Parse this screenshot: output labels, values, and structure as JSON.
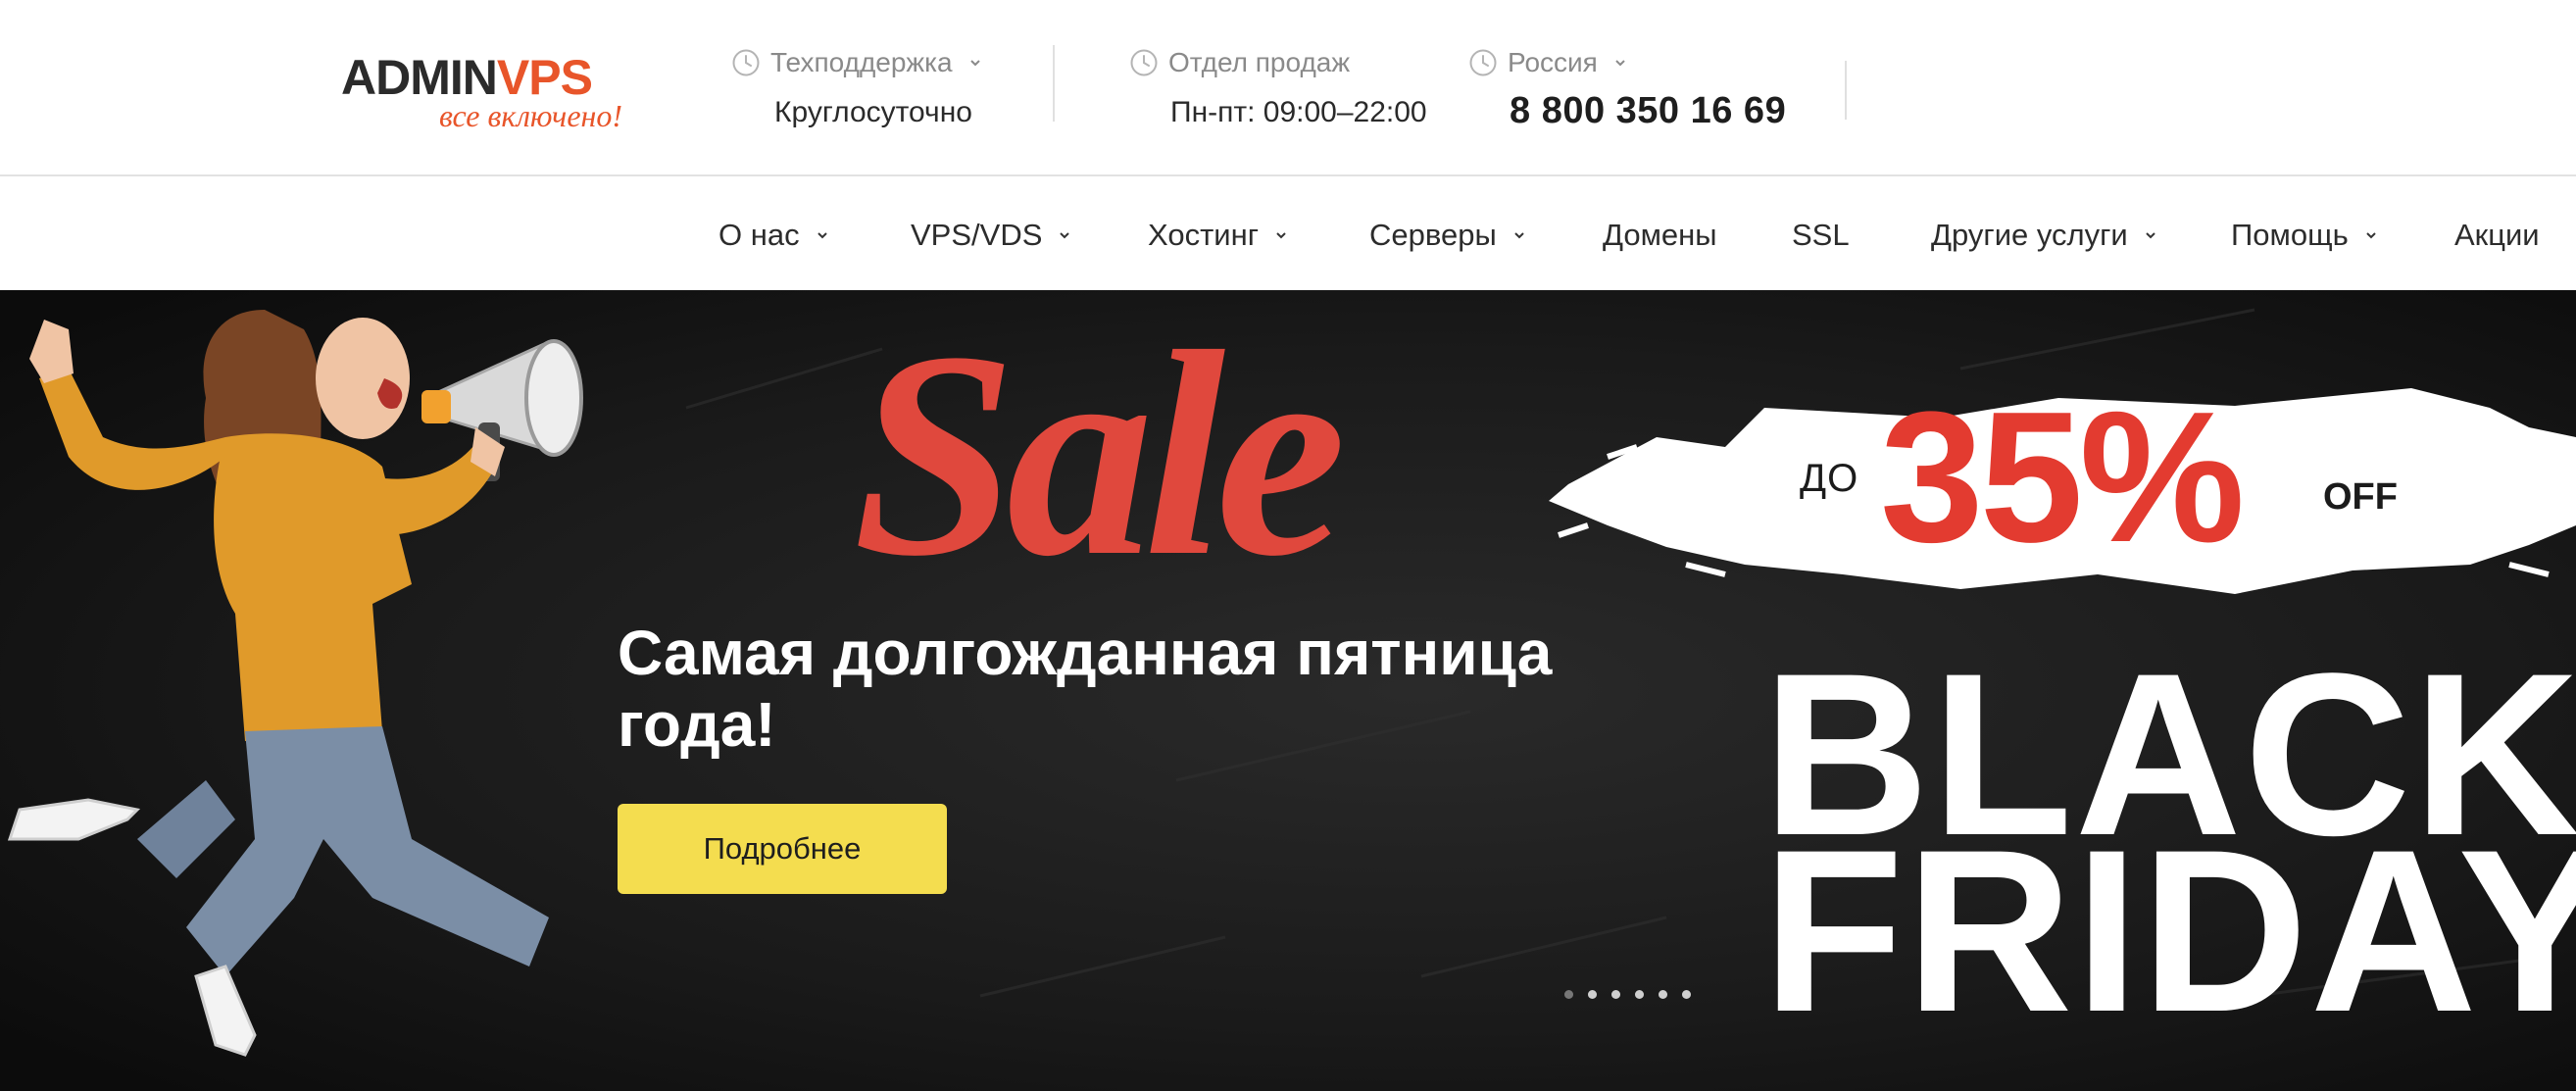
{
  "brand": {
    "logo_main": "ADMIN",
    "logo_accent": "VPS",
    "tagline": "все включено!"
  },
  "header": {
    "support": {
      "label": "Техподдержка",
      "value": "Круглосуточно",
      "icon": "clock-icon"
    },
    "sales": {
      "label": "Отдел продаж",
      "value": "Пн-пт: 09:00–22:00",
      "icon": "clock-icon"
    },
    "region": {
      "label": "Россия",
      "value": "8 800 350 16 69",
      "icon": "clock-icon"
    }
  },
  "nav": {
    "items": [
      {
        "label": "О нас",
        "dropdown": true
      },
      {
        "label": "VPS/VDS",
        "dropdown": true
      },
      {
        "label": "Хостинг",
        "dropdown": true
      },
      {
        "label": "Серверы",
        "dropdown": true
      },
      {
        "label": "Домены",
        "dropdown": false
      },
      {
        "label": "SSL",
        "dropdown": false
      },
      {
        "label": "Другие услуги",
        "dropdown": true
      },
      {
        "label": "Помощь",
        "dropdown": true
      },
      {
        "label": "Акции",
        "dropdown": false
      }
    ]
  },
  "hero": {
    "sale_word": "Sale",
    "title": "Самая долгожданная пятница года!",
    "button_label": "Подробнее",
    "promo_prefix": "ДО",
    "promo_percent": "35%",
    "promo_suffix": "OFF",
    "black": "BLACK",
    "friday": "FRIDAY",
    "slides_total": 6,
    "slide_active": 1
  },
  "colors": {
    "brand_orange": "#e8552a",
    "promo_red": "#e33b30",
    "sale_red": "#e0483d",
    "button_yellow": "#f4dd4f",
    "hero_bg": "#141414"
  }
}
